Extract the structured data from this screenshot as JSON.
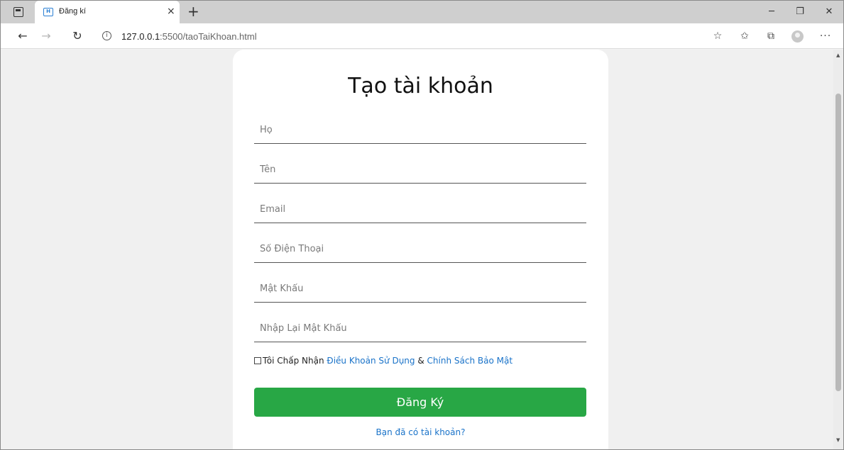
{
  "browser": {
    "tab": {
      "title": "Đăng kí",
      "favicon": "html-icon",
      "close": "×"
    },
    "new_tab": "+",
    "window_controls": {
      "minimize": "─",
      "maximize": "❐",
      "close": "✕"
    },
    "nav": {
      "back": "←",
      "forward": "→",
      "reload": "↻"
    },
    "address": {
      "host": "127.0.0.1",
      "path": ":5500/taoTaiKhoan.html"
    },
    "toolbar_icons": {
      "add_favorite": "☆",
      "favorites": "✩",
      "collections": "⧉",
      "more": "···"
    }
  },
  "form": {
    "title": "Tạo tài khoản",
    "fields": [
      {
        "placeholder": "Họ",
        "value": ""
      },
      {
        "placeholder": "Tên",
        "value": ""
      },
      {
        "placeholder": "Email",
        "value": ""
      },
      {
        "placeholder": "Số Điện Thoại",
        "value": ""
      },
      {
        "placeholder": "Mật Khẩu",
        "value": ""
      },
      {
        "placeholder": "Nhập Lại Mật Khẩu",
        "value": ""
      }
    ],
    "terms": {
      "prefix": "Tôi Chấp Nhận",
      "terms_link": "Điều Khoản Sử Dụng",
      "joiner": "&",
      "privacy_link": "Chính Sách Bảo Mật",
      "checked": false
    },
    "submit_label": "Đăng Ký",
    "login_link": "Bạn đã có tài khoản?"
  },
  "colors": {
    "accent_button": "#28a745",
    "link": "#1a73c9",
    "page_background": "#f0f0f0"
  }
}
